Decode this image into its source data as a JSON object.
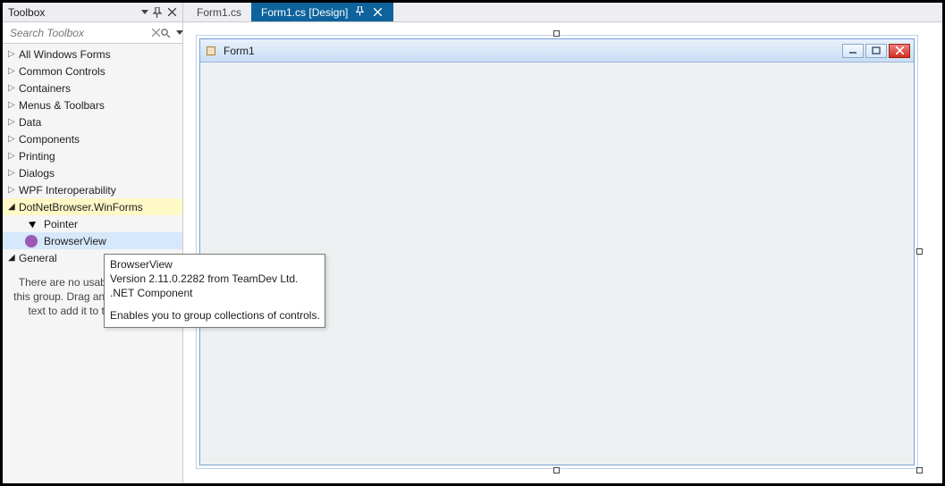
{
  "toolbox": {
    "title": "Toolbox",
    "search_placeholder": "Search Toolbox",
    "categories": [
      {
        "label": "All Windows Forms",
        "expanded": false
      },
      {
        "label": "Common Controls",
        "expanded": false
      },
      {
        "label": "Containers",
        "expanded": false
      },
      {
        "label": "Menus & Toolbars",
        "expanded": false
      },
      {
        "label": "Data",
        "expanded": false
      },
      {
        "label": "Components",
        "expanded": false
      },
      {
        "label": "Printing",
        "expanded": false
      },
      {
        "label": "Dialogs",
        "expanded": false
      },
      {
        "label": "WPF Interoperability",
        "expanded": false
      }
    ],
    "dotnetbrowser": {
      "label": "DotNetBrowser.WinForms",
      "pointer_label": "Pointer",
      "browserview_label": "BrowserView"
    },
    "general": {
      "label": "General",
      "empty_msg": "There are no usable controls in this group. Drag an item onto this text to add it to the toolbox."
    }
  },
  "tabs": {
    "inactive": "Form1.cs",
    "active": "Form1.cs [Design]"
  },
  "form": {
    "title": "Form1"
  },
  "tooltip": {
    "l1": "BrowserView",
    "l2": "Version 2.11.0.2282 from TeamDev Ltd.",
    "l3": ".NET Component",
    "l4": "Enables you to group collections of controls."
  }
}
